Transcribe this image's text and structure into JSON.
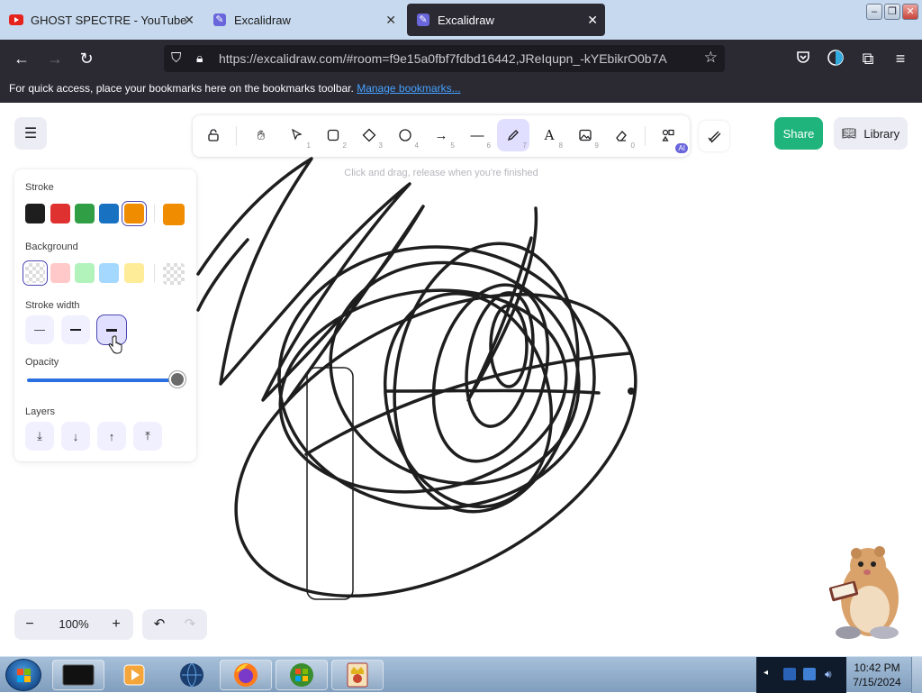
{
  "browser": {
    "tabs": [
      {
        "title": "GHOST SPECTRE - YouTube",
        "favicon": "youtube-icon",
        "active": false
      },
      {
        "title": "Excalidraw",
        "favicon": "excalidraw-icon",
        "active": false
      },
      {
        "title": "Excalidraw",
        "favicon": "excalidraw-icon",
        "active": true
      }
    ],
    "url": "https://excalidraw.com/#room=f9e15a0fbf7fdbd16442,JReIqupn_-kYEbikrO0b7A",
    "bookmarks_message": "For quick access, place your bookmarks here on the bookmarks toolbar.",
    "bookmarks_link": "Manage bookmarks..."
  },
  "excalidraw": {
    "hint": "Click and drag, release when you're finished",
    "share_label": "Share",
    "library_label": "Library",
    "tools": [
      {
        "name": "lock",
        "key": ""
      },
      {
        "name": "hand",
        "key": ""
      },
      {
        "name": "selection",
        "key": "1"
      },
      {
        "name": "rectangle",
        "key": "2"
      },
      {
        "name": "diamond",
        "key": "3"
      },
      {
        "name": "ellipse",
        "key": "4"
      },
      {
        "name": "arrow",
        "key": "5"
      },
      {
        "name": "line",
        "key": "6"
      },
      {
        "name": "draw",
        "key": "7",
        "selected": true
      },
      {
        "name": "text",
        "key": "8"
      },
      {
        "name": "image",
        "key": "9"
      },
      {
        "name": "eraser",
        "key": "0"
      },
      {
        "name": "more-tools",
        "key": "",
        "badge": "AI"
      }
    ],
    "properties": {
      "stroke_label": "Stroke",
      "stroke_colors": [
        "#1e1e1e",
        "#e03131",
        "#2f9e44",
        "#1971c2",
        "#f08c00"
      ],
      "stroke_selected": "#f08c00",
      "background_label": "Background",
      "background_colors": [
        "transparent",
        "#ffc9c9",
        "#b2f2bb",
        "#a5d8ff",
        "#ffec99"
      ],
      "background_selected": "transparent",
      "stroke_width_label": "Stroke width",
      "stroke_width_selected": "extra-bold",
      "opacity_label": "Opacity",
      "opacity_value": 100,
      "layers_label": "Layers"
    },
    "zoom": "100%"
  },
  "taskbar": {
    "time": "10:42 PM",
    "date": "7/15/2024",
    "apps": [
      "terminal",
      "media-player",
      "browser-globe",
      "firefox",
      "windows-xp",
      "king-game"
    ]
  },
  "colors": {
    "accent": "#6965db",
    "share": "#1fb47b",
    "browser_dark": "#2b2a33",
    "tab_strip": "#c7d9ee"
  }
}
